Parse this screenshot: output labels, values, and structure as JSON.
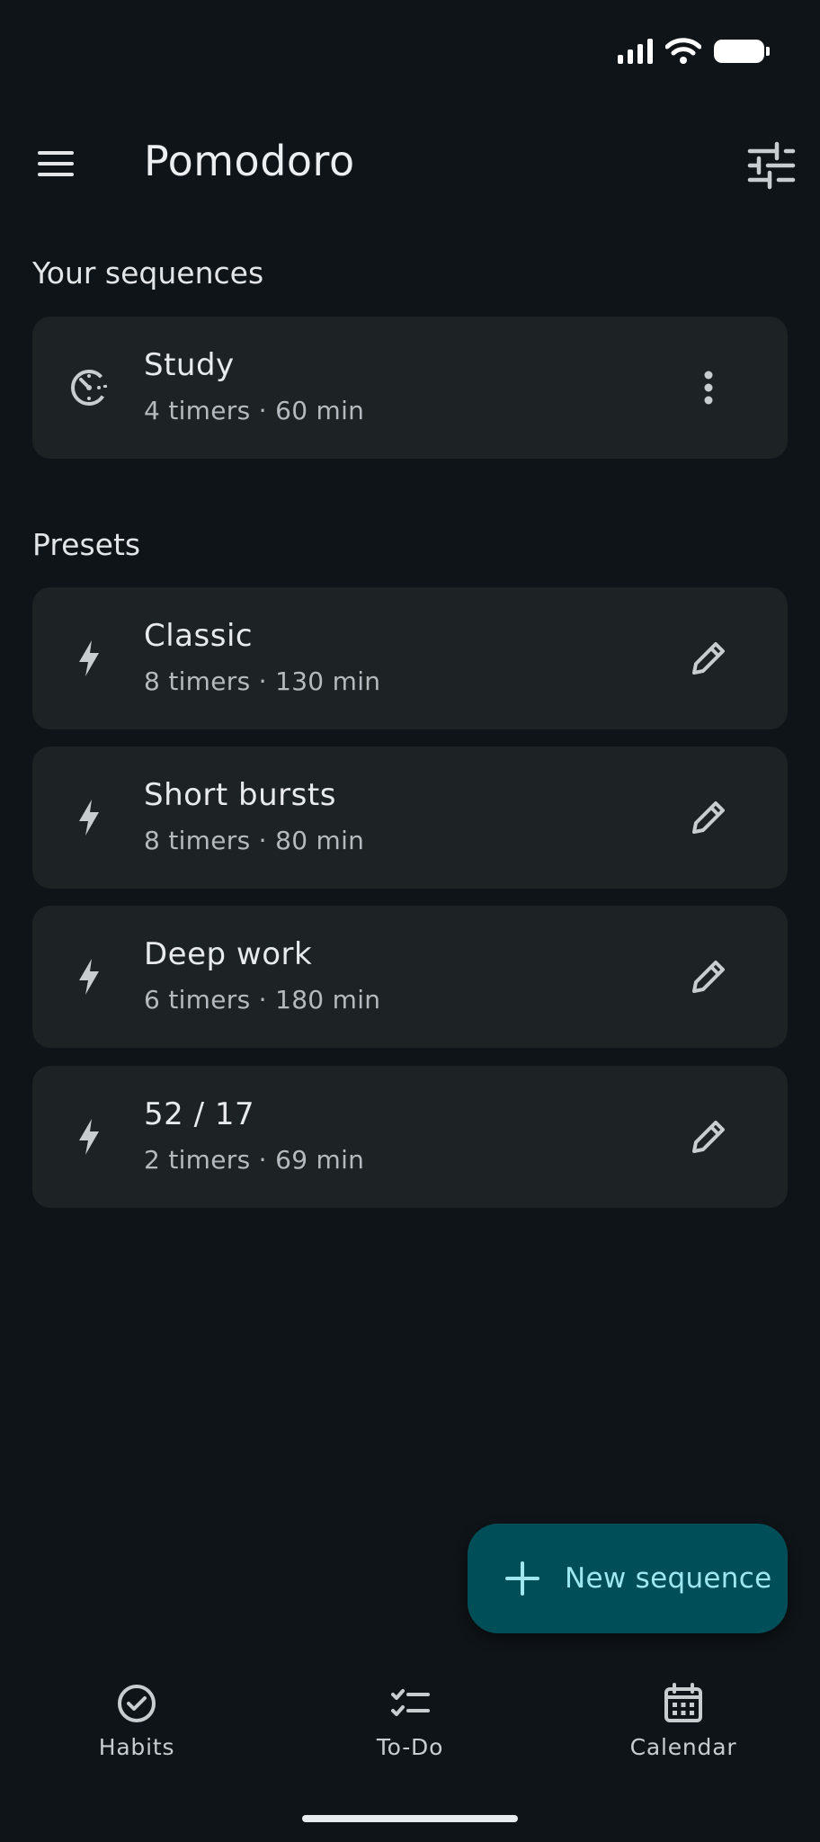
{
  "app": {
    "title": "Pomodoro"
  },
  "sections": {
    "sequences_label": "Your sequences",
    "presets_label": "Presets"
  },
  "sequences": [
    {
      "title": "Study",
      "subtitle": "4 timers · 60 min",
      "icon": "timer-icon",
      "action": "more-vert-icon"
    }
  ],
  "presets": [
    {
      "title": "Classic",
      "subtitle": "8 timers · 130 min",
      "icon": "bolt-icon",
      "action": "edit-icon"
    },
    {
      "title": "Short bursts",
      "subtitle": "8 timers · 80 min",
      "icon": "bolt-icon",
      "action": "edit-icon"
    },
    {
      "title": "Deep work",
      "subtitle": "6 timers · 180 min",
      "icon": "bolt-icon",
      "action": "edit-icon"
    },
    {
      "title": "52 / 17",
      "subtitle": "2 timers · 69 min",
      "icon": "bolt-icon",
      "action": "edit-icon"
    }
  ],
  "fab": {
    "label": "New sequence",
    "icon": "plus-icon"
  },
  "bottom_nav": [
    {
      "label": "Habits",
      "icon": "check-circle-icon"
    },
    {
      "label": "To-Do",
      "icon": "checklist-icon"
    },
    {
      "label": "Calendar",
      "icon": "calendar-icon"
    }
  ],
  "colors": {
    "background": "#0f1418",
    "card": "#1d2225",
    "fab_background": "#004e58",
    "fab_foreground": "#9fe7f0"
  }
}
